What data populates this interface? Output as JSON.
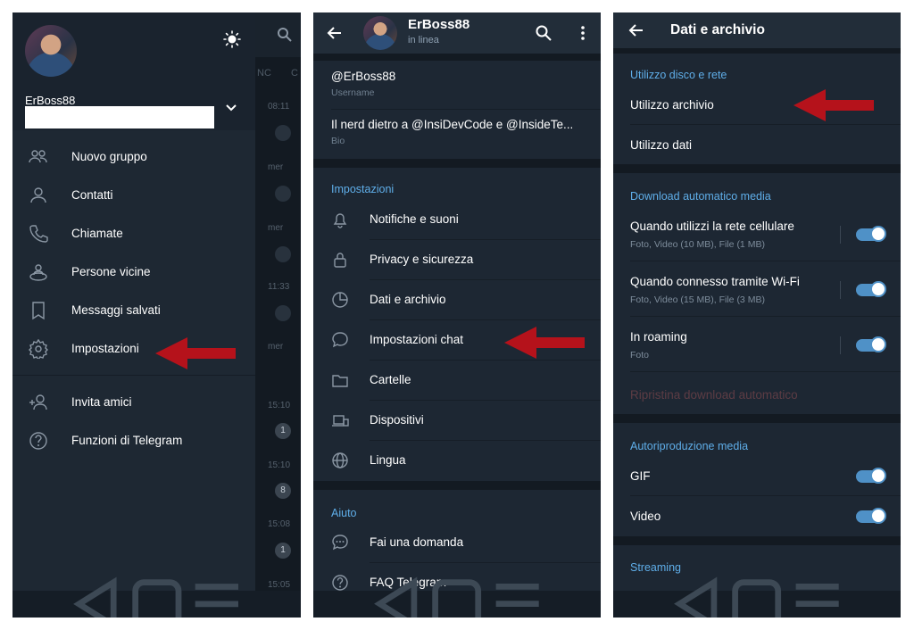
{
  "panel1": {
    "user": {
      "name": "ErBoss88"
    },
    "chat_tabs": [
      "NC",
      "C"
    ],
    "chat_times": [
      "08:11",
      "mer",
      "mer",
      "11:33",
      "mer",
      "15:10",
      "15:10",
      "15:08",
      "15:05"
    ],
    "chat_badges": [
      "1",
      "8",
      "1"
    ],
    "menu": [
      {
        "label": "Nuovo gruppo",
        "icon": "group-icon"
      },
      {
        "label": "Contatti",
        "icon": "contact-icon"
      },
      {
        "label": "Chiamate",
        "icon": "phone-icon"
      },
      {
        "label": "Persone vicine",
        "icon": "people-nearby-icon"
      },
      {
        "label": "Messaggi salvati",
        "icon": "bookmark-icon"
      },
      {
        "label": "Impostazioni",
        "icon": "gear-icon"
      }
    ],
    "menu2": [
      {
        "label": "Invita amici",
        "icon": "add-user-icon"
      },
      {
        "label": "Funzioni di Telegram",
        "icon": "help-icon"
      }
    ]
  },
  "panel2": {
    "header": {
      "name": "ErBoss88",
      "status": "in linea"
    },
    "username": {
      "value": "@ErBoss88",
      "label": "Username"
    },
    "bio": {
      "value": "Il nerd dietro a @InsiDevCode e @InsideTe...",
      "label": "Bio"
    },
    "settings_title": "Impostazioni",
    "settings": [
      {
        "label": "Notifiche e suoni",
        "icon": "bell-icon"
      },
      {
        "label": "Privacy e sicurezza",
        "icon": "lock-icon"
      },
      {
        "label": "Dati e archivio",
        "icon": "clock-chart-icon"
      },
      {
        "label": "Impostazioni chat",
        "icon": "chat-bubble-icon"
      },
      {
        "label": "Cartelle",
        "icon": "folder-icon"
      },
      {
        "label": "Dispositivi",
        "icon": "devices-icon"
      },
      {
        "label": "Lingua",
        "icon": "globe-icon"
      }
    ],
    "help_title": "Aiuto",
    "help": [
      {
        "label": "Fai una domanda",
        "icon": "question-bubble-icon"
      },
      {
        "label": "FAQ Telegram",
        "icon": "help-icon"
      }
    ]
  },
  "panel3": {
    "title": "Dati e archivio",
    "disk_title": "Utilizzo disco e rete",
    "disk": [
      {
        "label": "Utilizzo archivio"
      },
      {
        "label": "Utilizzo dati"
      }
    ],
    "auto_title": "Download automatico media",
    "auto": [
      {
        "label": "Quando utilizzi la rete cellulare",
        "sub": "Foto, Video (10 MB), File (1 MB)",
        "on": true
      },
      {
        "label": "Quando connesso tramite Wi-Fi",
        "sub": "Foto, Video (15 MB), File (3 MB)",
        "on": true
      },
      {
        "label": "In roaming",
        "sub": "Foto",
        "on": true
      }
    ],
    "reset": "Ripristina download automatico",
    "autoplay_title": "Autoriproduzione media",
    "autoplay": [
      {
        "label": "GIF",
        "on": true
      },
      {
        "label": "Video",
        "on": true
      }
    ],
    "streaming_title": "Streaming"
  },
  "colors": {
    "bg": "#1d2733",
    "accent": "#5faee9",
    "arrow": "#b5121b",
    "toggle": "#4f91c7"
  }
}
